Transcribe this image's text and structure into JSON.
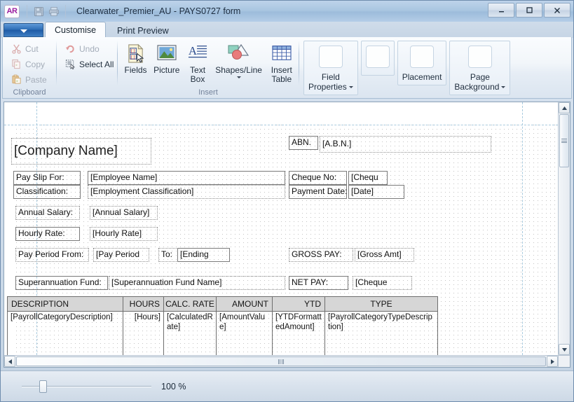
{
  "window": {
    "app_icon_text": "AR",
    "title": "Clearwater_Premier_AU - PAYS0727 form",
    "quick_access": [
      {
        "name": "save",
        "icon": "save-icon",
        "enabled": false
      },
      {
        "name": "print",
        "icon": "print-icon",
        "enabled": false
      }
    ],
    "controls": {
      "minimize": "minimize-icon",
      "maximize": "maximize-icon",
      "close": "close-icon"
    }
  },
  "ribbon": {
    "app_button": "office-menu-button",
    "tabs": [
      {
        "label": "Customise",
        "active": true
      },
      {
        "label": "Print Preview",
        "active": false
      }
    ],
    "groups": [
      {
        "label": "Clipboard",
        "items": [
          {
            "label": "Cut",
            "icon": "cut-icon",
            "enabled": false
          },
          {
            "label": "Copy",
            "icon": "copy-icon",
            "enabled": false
          },
          {
            "label": "Paste",
            "icon": "paste-icon",
            "enabled": false
          }
        ]
      },
      {
        "label": "",
        "items": [
          {
            "label": "Undo",
            "icon": "undo-icon",
            "enabled": false
          },
          {
            "label": "Select All",
            "icon": "select-all-icon",
            "enabled": true
          }
        ]
      },
      {
        "label": "Insert",
        "items": [
          {
            "label": "Fields",
            "icon": "fields-icon",
            "dropdown": false
          },
          {
            "label": "Picture",
            "icon": "picture-icon",
            "dropdown": false
          },
          {
            "label": "Text\nBox",
            "icon": "text-box-icon",
            "dropdown": false
          },
          {
            "label": "Shapes/Line",
            "icon": "shapes-line-icon",
            "dropdown": true
          },
          {
            "label": "Insert\nTable",
            "icon": "insert-table-icon",
            "dropdown": true
          }
        ]
      }
    ],
    "panel_buttons": [
      {
        "label": "Field\nProperties",
        "dropdown": true
      },
      {
        "label": "",
        "dropdown": false
      },
      {
        "label": "Placement",
        "dropdown": true
      },
      {
        "label": "Page\nBackground",
        "dropdown": true
      }
    ]
  },
  "form": {
    "title_field": "[Company Name]",
    "fields": [
      {
        "label": "Pay Slip For:",
        "value": "[Employee Name]"
      },
      {
        "label": "Classification:",
        "value": "[Employment Classification]"
      },
      {
        "label": "Annual Salary:",
        "value": "[Annual Salary]"
      },
      {
        "label": "Hourly Rate:",
        "value": "[Hourly Rate]"
      },
      {
        "label": "Pay Period From:",
        "value": "[Pay Period"
      },
      {
        "label": "To:",
        "value": "[Ending"
      },
      {
        "label": "Superannuation Fund:",
        "value": "[Superannuation Fund Name]"
      },
      {
        "label": "ABN.",
        "value": "[A.B.N.]"
      },
      {
        "label": "Cheque No:",
        "value": "[Chequ"
      },
      {
        "label": "Payment Date:",
        "value": "[Date]"
      },
      {
        "label": "GROSS PAY:",
        "value": "[Gross Amt]"
      },
      {
        "label": "NET PAY:",
        "value": "[Cheque"
      }
    ],
    "table": {
      "columns": [
        "DESCRIPTION",
        "HOURS",
        "CALC. RATE",
        "AMOUNT",
        "YTD",
        "TYPE"
      ],
      "rows": [
        [
          "[PayrollCategoryDescription]",
          "[Hours]",
          "[CalculatedRate]",
          "[AmountValue]",
          "[YTDFormattedAmount]",
          "[PayrollCategoryTypeDescription]"
        ]
      ]
    }
  },
  "status": {
    "zoom_label": "100 %",
    "zoom_value": 100
  }
}
